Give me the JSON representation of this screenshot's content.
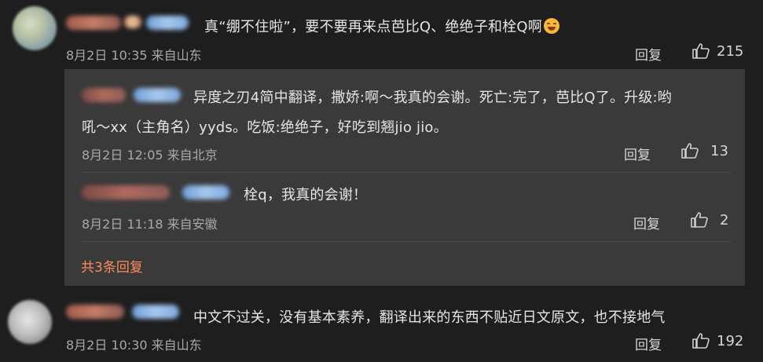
{
  "comments": [
    {
      "text": "真“绷不住啦”，要不要再来点芭比Q、绝绝子和栓Q啊",
      "emoji": "hugging-face-emoji",
      "date": "8月2日 10:35 来自山东",
      "reply_label": "回复",
      "likes": "215",
      "replies": [
        {
          "text_line1": "异度之刃4简中翻译，撒娇:啊～我真的会谢。死亡:完了，芭比Q了。升级:哟",
          "text_line2": "吼～xx（主角名）yyds。吃饭:绝绝子，好吃到翘jio jio。",
          "date": "8月2日 12:05 来自北京",
          "reply_label": "回复",
          "likes": "13"
        },
        {
          "text": "栓q，我真的会谢！",
          "date": "8月2日 11:18 来自安徽",
          "reply_label": "回复",
          "likes": "2"
        }
      ],
      "more_replies": "共3条回复"
    },
    {
      "text": "中文不过关，没有基本素养，翻译出来的东西不贴近日文原文，也不接地气",
      "date": "8月2日 10:30 来自山东",
      "reply_label": "回复",
      "likes": "192"
    }
  ],
  "colors": {
    "background": "#1e1e1e",
    "reply_box": "#3a3a3a",
    "more_link": "#ff8b57",
    "meta_text": "#a9a9a9"
  }
}
